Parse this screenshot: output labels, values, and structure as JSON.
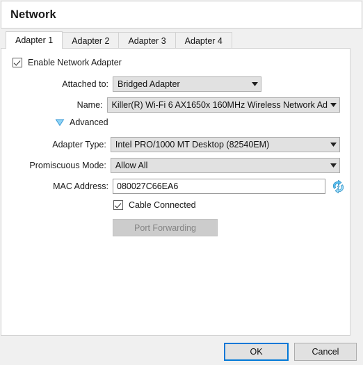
{
  "dialog": {
    "title": "Network"
  },
  "tabs": [
    {
      "label": "Adapter 1",
      "active": true
    },
    {
      "label": "Adapter 2",
      "active": false
    },
    {
      "label": "Adapter 3",
      "active": false
    },
    {
      "label": "Adapter 4",
      "active": false
    }
  ],
  "form": {
    "enable_adapter": {
      "label": "Enable Network Adapter",
      "checked": true
    },
    "attached_to": {
      "label": "Attached to:",
      "value": "Bridged Adapter"
    },
    "name": {
      "label": "Name:",
      "value": "Killer(R) Wi-Fi 6 AX1650x 160MHz Wireless Network Ad"
    },
    "advanced": {
      "label": "Advanced",
      "expanded": true
    },
    "adapter_type": {
      "label": "Adapter Type:",
      "value": "Intel PRO/1000 MT Desktop (82540EM)"
    },
    "promiscuous_mode": {
      "label": "Promiscuous Mode:",
      "value": "Allow All"
    },
    "mac_address": {
      "label": "MAC Address:",
      "value": "080027C66EA6",
      "refresh_icon": "refresh-mac-icon"
    },
    "cable_connected": {
      "label": "Cable Connected",
      "checked": true
    },
    "port_forwarding": {
      "label": "Port Forwarding",
      "enabled": false
    }
  },
  "footer": {
    "ok_label": "OK",
    "cancel_label": "Cancel"
  },
  "colors": {
    "accent": "#0078d7",
    "panel_bg": "#ffffff",
    "window_bg": "#f0f0f0",
    "control_bg": "#e1e1e1",
    "advanced_triangle": "#7ec8f0"
  }
}
